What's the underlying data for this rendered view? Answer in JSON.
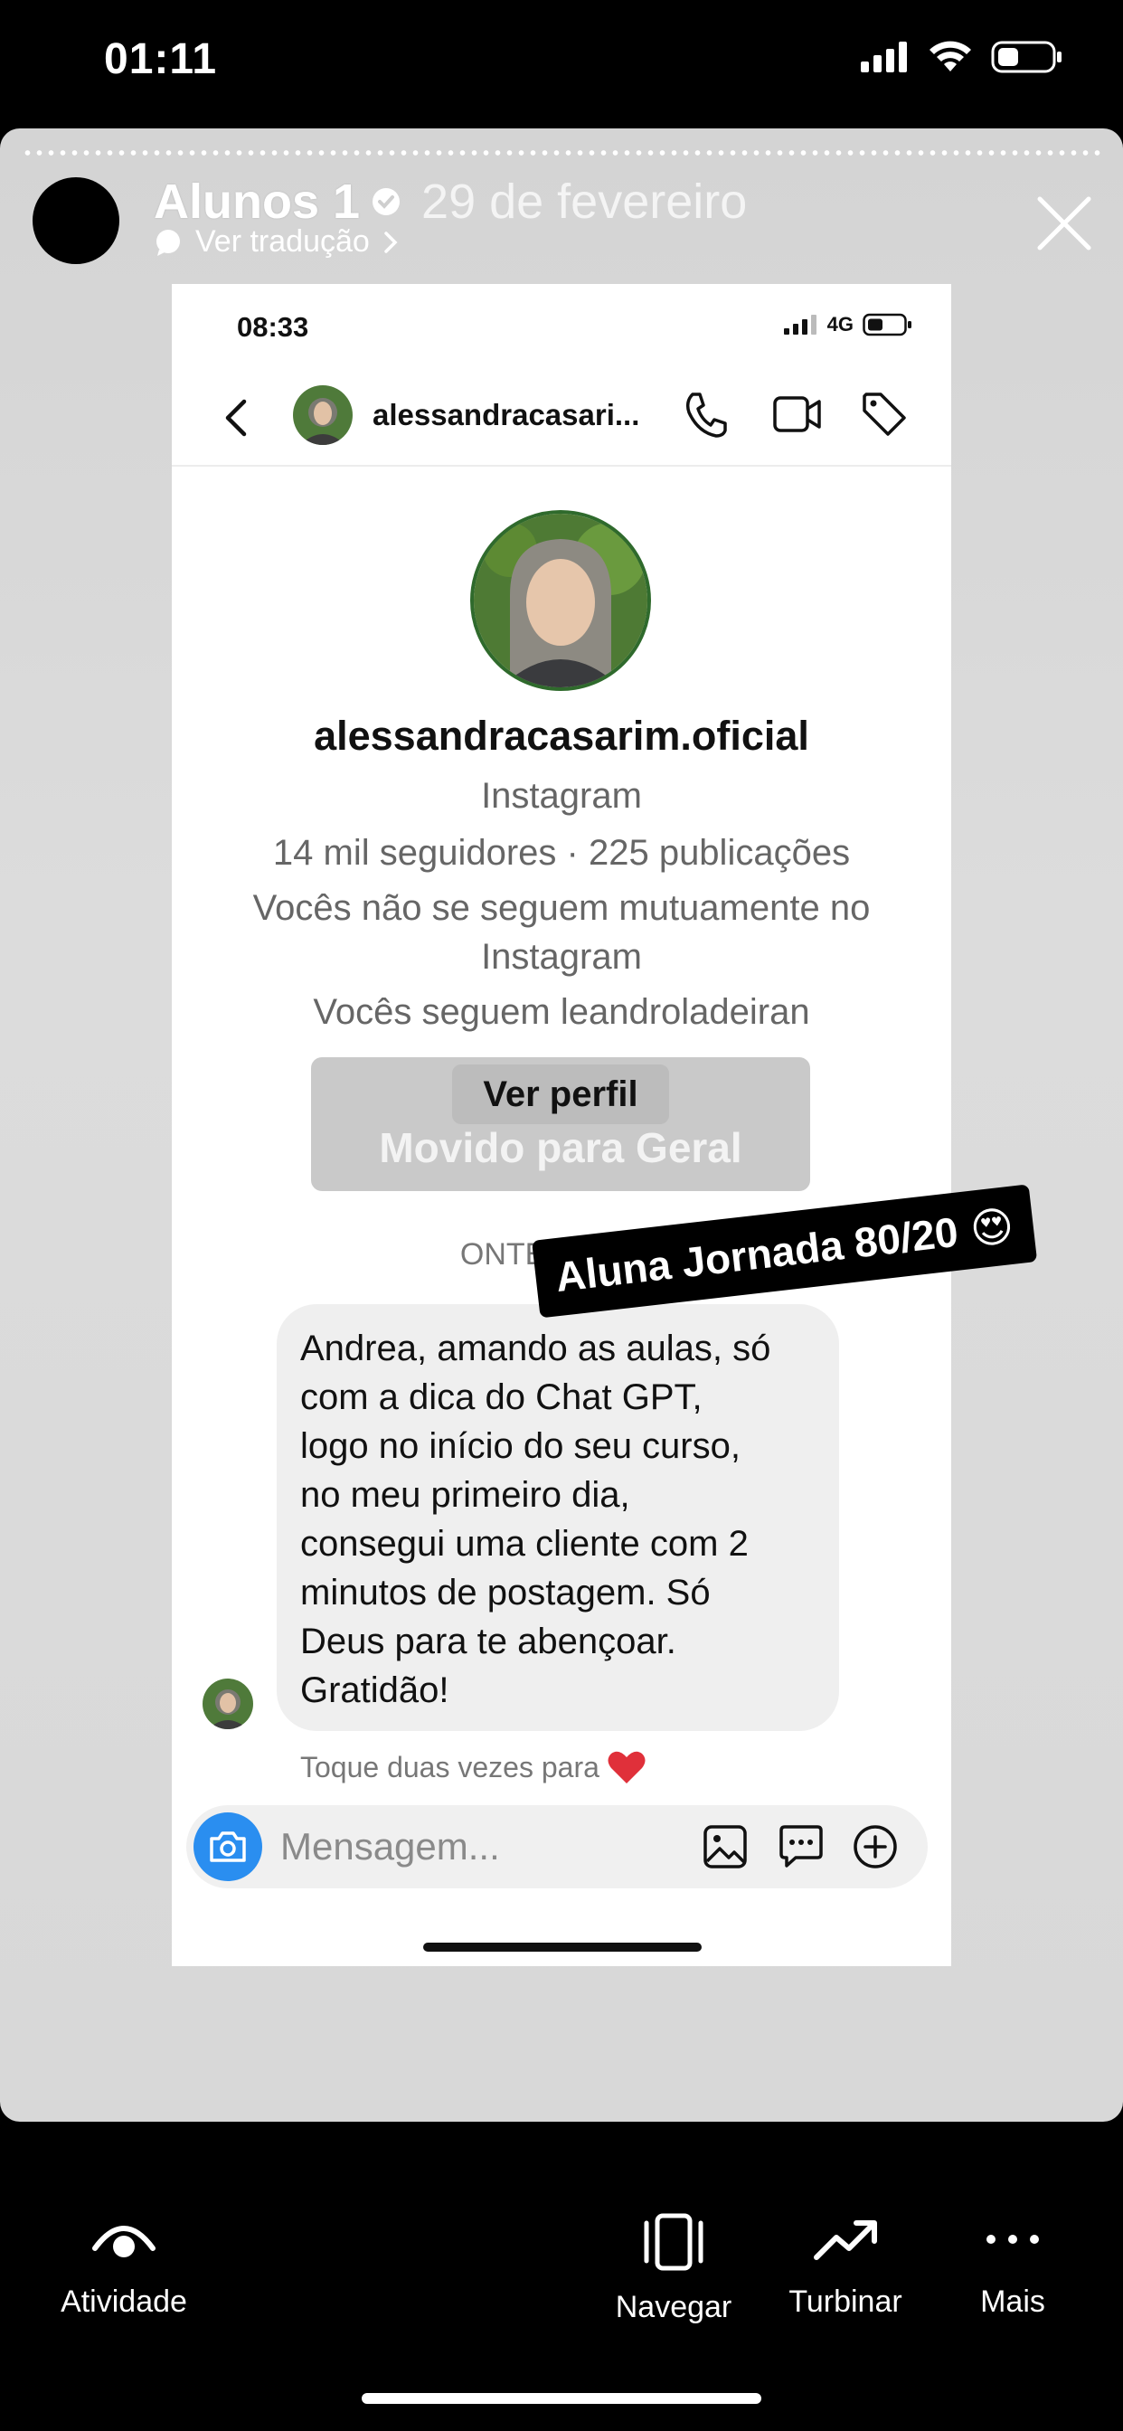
{
  "status_bar": {
    "time": "01:11"
  },
  "story": {
    "username": "Alunos 1",
    "date": "29 de fevereiro",
    "translate_label": "Ver tradução"
  },
  "screenshot": {
    "status_time": "08:33",
    "network": "4G",
    "header_username": "alessandracasari...",
    "profile_name": "alessandracasarim.oficial",
    "platform": "Instagram",
    "stats": "14 mil seguidores · 225 publicações",
    "mutual_line1": "Vocês não se seguem mutuamente no",
    "mutual_line2": "Instagram",
    "follows": "Vocês seguem leandroladeiran",
    "view_profile": "Ver perfil",
    "moved": "Movido para Geral",
    "timestamp": "ONTEM, 11:32",
    "message_lines": [
      "Andrea, amando as aulas, só",
      "com a dica do Chat GPT,",
      "logo no início do seu curso,",
      "no meu primeiro dia,",
      "consegui uma cliente com 2",
      "minutos de postagem. Só",
      "Deus para te abençoar.",
      "Gratidão!"
    ],
    "double_tap_hint": "Toque duas vezes para",
    "composer_placeholder": "Mensagem..."
  },
  "sticker": {
    "text": "Aluna Jornada 80/20",
    "emoji": "😍"
  },
  "bottom_bar": {
    "activity": "Atividade",
    "navigate": "Navegar",
    "boost": "Turbinar",
    "more": "Mais"
  },
  "colors": {
    "accent_blue": "#2a8ef0",
    "heart_red": "#e0303a",
    "story_bg": "#d6d6d6"
  },
  "icons": [
    "wifi-icon",
    "battery-icon",
    "signal-icon",
    "verified-icon",
    "close-icon",
    "back-icon",
    "phone-icon",
    "video-icon",
    "tag-icon",
    "camera-icon",
    "gallery-icon",
    "sticker-icon",
    "plus-icon",
    "eye-icon",
    "navigate-icon",
    "trending-icon",
    "more-icon",
    "heart-icon"
  ]
}
